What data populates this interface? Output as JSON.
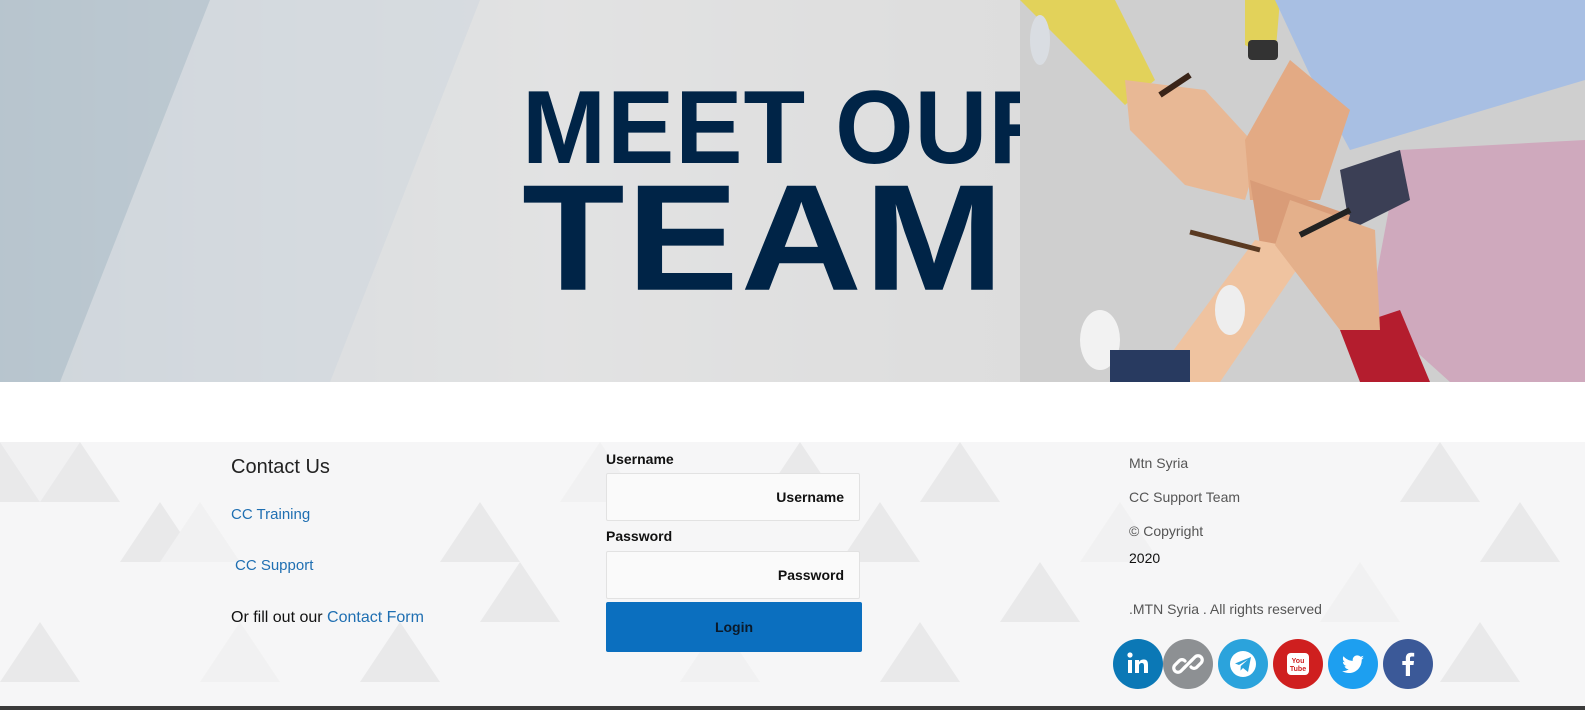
{
  "hero": {
    "line1": "MEET OUR",
    "line2": "TEAM!"
  },
  "contact": {
    "title": "Contact Us",
    "cc_training": "CC Training",
    "cc_support": "CC Support",
    "fill_prefix": "Or fill out our ",
    "contact_form": "Contact Form"
  },
  "login": {
    "username_label": "Username",
    "username_placeholder": "Username",
    "password_label": "Password",
    "password_placeholder": "Password",
    "login_button": "Login"
  },
  "info": {
    "company": "Mtn Syria",
    "team": "CC Support Team",
    "copyright": "© Copyright",
    "year": "2020",
    "rights": ".MTN Syria . All rights reserved"
  },
  "social": {
    "icons": [
      "linkedin-icon",
      "link-icon",
      "telegram-icon",
      "youtube-icon",
      "twitter-icon",
      "facebook-icon"
    ],
    "colors": {
      "linkedin": "#0b78b6",
      "link": "#8d9093",
      "telegram": "#2ba3dc",
      "youtube": "#cf1f1f",
      "twitter": "#1d9ff0",
      "facebook": "#3b5998"
    }
  },
  "colors": {
    "hero_text": "#002447",
    "link": "#1f6fb2",
    "login_button": "#0b6fbf",
    "footer_bg": "#f6f6f7"
  }
}
